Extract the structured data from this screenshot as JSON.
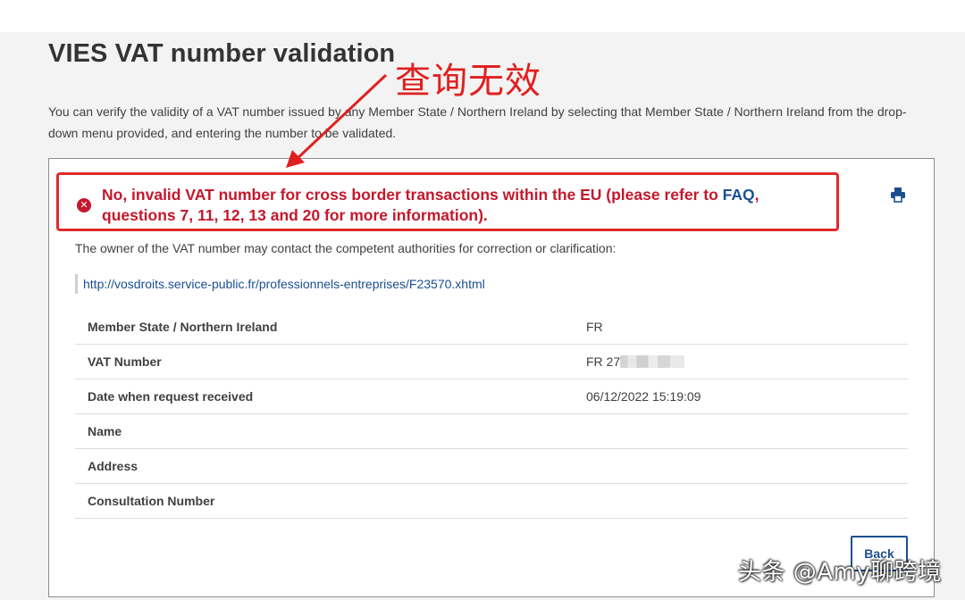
{
  "page": {
    "title": "VIES VAT number validation",
    "intro": "You can verify the validity of a VAT number issued by any Member State / Northern Ireland by selecting that Member State / Northern Ireland from the drop-down menu provided, and entering the number to be validated."
  },
  "annotation": {
    "label": "查询无效"
  },
  "result": {
    "error_prefix": "No, invalid VAT number for cross border transactions within the EU (please refer to ",
    "faq_link": "FAQ",
    "error_suffix": ", questions 7, 11, 12, 13 and 20 for more information).",
    "owner_note": "The owner of the VAT number may contact the competent authorities for correction or clarification:",
    "service_link": "http://vosdroits.service-public.fr/professionnels-entreprises/F23570.xhtml",
    "details": [
      {
        "label": "Member State / Northern Ireland",
        "value": "FR"
      },
      {
        "label": "VAT Number",
        "value": "FR 27"
      },
      {
        "label": "Date when request received",
        "value": "06/12/2022 15:19:09"
      },
      {
        "label": "Name",
        "value": ""
      },
      {
        "label": "Address",
        "value": ""
      },
      {
        "label": "Consultation Number",
        "value": ""
      }
    ],
    "back_label": "Back"
  },
  "watermark": "头条 @Amy聊跨境",
  "icons": {
    "error": "error-circle-icon",
    "print": "print-icon"
  },
  "colors": {
    "error": "#c4182c",
    "annotation": "#e02020",
    "link": "#1a4f91"
  }
}
